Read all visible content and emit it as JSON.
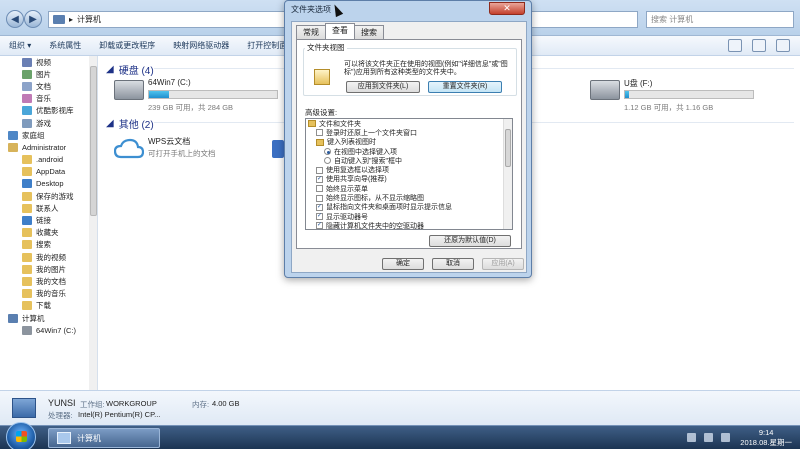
{
  "explorer": {
    "address": "计算机",
    "search_placeholder": "搜索 计算机",
    "toolbar": [
      "组织 ▾",
      "系统属性",
      "卸载或更改程序",
      "映射网络驱动器",
      "打开控制面板"
    ],
    "sidebar": [
      {
        "label": "视频",
        "color": "#6a7fb4",
        "indent": 1
      },
      {
        "label": "图片",
        "color": "#6aa26a",
        "indent": 1
      },
      {
        "label": "文档",
        "color": "#8ca3c9",
        "indent": 1
      },
      {
        "label": "音乐",
        "color": "#c07ab5",
        "indent": 1
      },
      {
        "label": "优酷影视库",
        "color": "#4aa6d9",
        "indent": 1
      },
      {
        "label": "游戏",
        "color": "#7f9bbd",
        "indent": 1
      },
      {
        "label": "家庭组",
        "color": "#4f87c6",
        "indent": 0
      },
      {
        "label": "Administrator",
        "color": "#d7b35a",
        "indent": 0
      },
      {
        "label": ".android",
        "color": "#e6c15c",
        "indent": 1
      },
      {
        "label": "AppData",
        "color": "#e6c15c",
        "indent": 1
      },
      {
        "label": "Desktop",
        "color": "#3f7fc9",
        "indent": 1
      },
      {
        "label": "保存的游戏",
        "color": "#e6c15c",
        "indent": 1
      },
      {
        "label": "联系人",
        "color": "#e6c15c",
        "indent": 1
      },
      {
        "label": "链接",
        "color": "#3f7fc9",
        "indent": 1
      },
      {
        "label": "收藏夹",
        "color": "#e6c15c",
        "indent": 1
      },
      {
        "label": "搜索",
        "color": "#e6c15c",
        "indent": 1
      },
      {
        "label": "我的视频",
        "color": "#e6c15c",
        "indent": 1
      },
      {
        "label": "我的图片",
        "color": "#e6c15c",
        "indent": 1
      },
      {
        "label": "我的文档",
        "color": "#e6c15c",
        "indent": 1
      },
      {
        "label": "我的音乐",
        "color": "#e6c15c",
        "indent": 1
      },
      {
        "label": "下载",
        "color": "#e6c15c",
        "indent": 1
      },
      {
        "label": "计算机",
        "color": "#5a7fb0",
        "indent": 0
      },
      {
        "label": "64Win7 (C:)",
        "color": "#8c949e",
        "indent": 1
      }
    ],
    "groups": {
      "hard_disk_title": "硬盘 (4)",
      "other_title": "其他 (2)"
    },
    "drives": [
      {
        "name": "64Win7 (C:)",
        "info": "239 GB 可用，共 284 GB",
        "used_fraction": 0.16
      },
      {
        "name": "U盘 (F:)",
        "info": "1.12 GB 可用，共 1.16 GB",
        "used_fraction": 0.03
      }
    ],
    "other_items": [
      {
        "name": "WPS云文档",
        "info": "可打开手机上的文档"
      }
    ],
    "details": {
      "name": "YUNSI",
      "workgroup_label": "工作组:",
      "workgroup": "WORKGROUP",
      "memory_label": "内存:",
      "memory": "4.00 GB",
      "cpu_label": "处理器:",
      "cpu": "Intel(R) Pentium(R) CP..."
    }
  },
  "dialog": {
    "title": "文件夹选项",
    "close": "✕",
    "tabs": [
      "常规",
      "查看",
      "搜索"
    ],
    "active_tab": "查看",
    "folder_views_legend": "文件夹视图",
    "folder_views_text": "可以将该文件夹正在使用的视图(例如\"详细信息\"或\"图标\")应用到所有这种类型的文件夹中。",
    "apply_to_folders": "应用到文件夹(L)",
    "reset_folders": "重置文件夹(R)",
    "advanced_label": "高级设置:",
    "tree": [
      {
        "kind": "folder",
        "label": "文件和文件夹",
        "indent": 0
      },
      {
        "kind": "check",
        "checked": false,
        "label": "登录时还原上一个文件夹窗口",
        "indent": 1
      },
      {
        "kind": "folder",
        "label": "键入列表视图时",
        "indent": 1
      },
      {
        "kind": "radio",
        "checked": true,
        "label": "在视图中选择键入项",
        "indent": 2
      },
      {
        "kind": "radio",
        "checked": false,
        "label": "自动键入到\"搜索\"框中",
        "indent": 2
      },
      {
        "kind": "check",
        "checked": false,
        "label": "使用复选框以选择项",
        "indent": 1
      },
      {
        "kind": "check",
        "checked": true,
        "label": "使用共享向导(推荐)",
        "indent": 1
      },
      {
        "kind": "check",
        "checked": false,
        "label": "始终显示菜单",
        "indent": 1
      },
      {
        "kind": "check",
        "checked": false,
        "label": "始终显示图标，从不显示缩略图",
        "indent": 1
      },
      {
        "kind": "check",
        "checked": true,
        "label": "鼠标指向文件夹和桌面项时显示提示信息",
        "indent": 1
      },
      {
        "kind": "check",
        "checked": true,
        "label": "显示驱动器号",
        "indent": 1
      },
      {
        "kind": "check",
        "checked": true,
        "label": "隐藏计算机文件夹中的空驱动器",
        "indent": 1
      },
      {
        "kind": "check",
        "checked": true,
        "label": "隐藏受保护的操作系统文件(推荐)",
        "indent": 1
      }
    ],
    "restore_defaults": "还原为默认值(D)",
    "ok": "确定",
    "cancel": "取消",
    "apply": "应用(A)"
  },
  "taskbar": {
    "task_label": "计算机",
    "time": "9:14",
    "date": "2018.08.星期一"
  }
}
